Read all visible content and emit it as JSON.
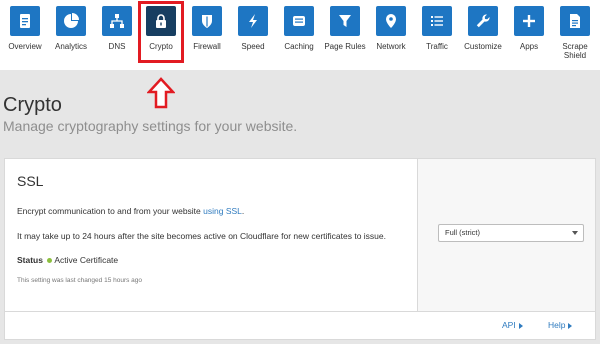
{
  "nav": {
    "items": [
      {
        "label": "Overview",
        "icon": "document-icon"
      },
      {
        "label": "Analytics",
        "icon": "pie-chart-icon"
      },
      {
        "label": "DNS",
        "icon": "network-tree-icon"
      },
      {
        "label": "Crypto",
        "icon": "lock-icon"
      },
      {
        "label": "Firewall",
        "icon": "shield-icon"
      },
      {
        "label": "Speed",
        "icon": "lightning-icon"
      },
      {
        "label": "Caching",
        "icon": "server-icon"
      },
      {
        "label": "Page Rules",
        "icon": "filter-icon"
      },
      {
        "label": "Network",
        "icon": "location-pin-icon"
      },
      {
        "label": "Traffic",
        "icon": "list-icon"
      },
      {
        "label": "Customize",
        "icon": "wrench-icon"
      },
      {
        "label": "Apps",
        "icon": "plus-icon"
      },
      {
        "label": "Scrape Shield",
        "icon": "document-text-icon"
      }
    ],
    "active": "Crypto",
    "highlight_color": "#e21b22"
  },
  "page": {
    "title": "Crypto",
    "subtitle": "Manage cryptography settings for your website."
  },
  "ssl": {
    "title": "SSL",
    "description_prefix": "Encrypt communication to and from your website ",
    "description_link": "using SSL",
    "description_suffix": ".",
    "note": "It may take up to 24 hours after the site becomes active on Cloudflare for new certificates to issue.",
    "status_label": "Status",
    "status_value": "Active Certificate",
    "last_changed": "This setting was last changed 15 hours ago",
    "mode_selected": "Full (strict)"
  },
  "footer": {
    "api_label": "API",
    "help_label": "Help"
  },
  "colors": {
    "nav_tile": "#1e76c3",
    "nav_tile_active": "#173e61",
    "link": "#2f7bbf",
    "status_ok": "#8cbf3f"
  }
}
